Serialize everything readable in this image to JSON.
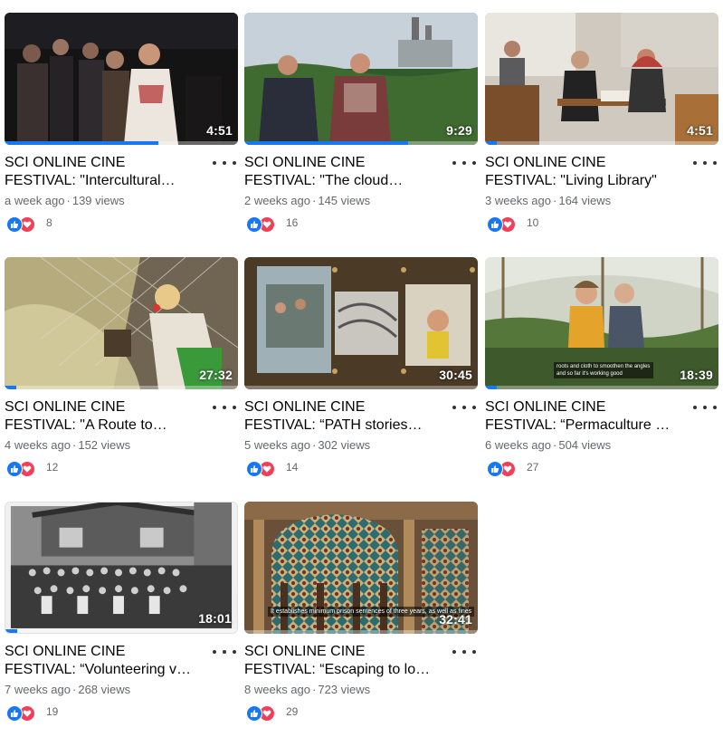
{
  "colors": {
    "accent": "#1877f2",
    "like": "#1877f2",
    "love": "#f33e58",
    "meta_text": "#65676b"
  },
  "icons": {
    "menu": "three-dots-icon",
    "like": "thumbs-up-icon",
    "love": "heart-icon"
  },
  "videos": [
    {
      "title_line1": "SCI ONLINE CINE",
      "title_line2": "FESTIVAL: \"Intercultural…",
      "duration": "4:51",
      "age": "a week ago",
      "views": "139 views",
      "reactions": "8",
      "progress": 0.66
    },
    {
      "title_line1": "SCI ONLINE CINE",
      "title_line2": "FESTIVAL: \"The cloud…",
      "duration": "9:29",
      "age": "2 weeks ago",
      "views": "145 views",
      "reactions": "16",
      "progress": 0.7
    },
    {
      "title_line1": "SCI ONLINE CINE",
      "title_line2": "FESTIVAL: \"Living Library\"",
      "duration": "4:51",
      "age": "3 weeks ago",
      "views": "164 views",
      "reactions": "10",
      "progress": 0.05
    },
    {
      "title_line1": "SCI ONLINE CINE",
      "title_line2": "FESTIVAL: \"A Route to…",
      "duration": "27:32",
      "age": "4 weeks ago",
      "views": "152 views",
      "reactions": "12",
      "progress": 0.05
    },
    {
      "title_line1": "SCI ONLINE CINE",
      "title_line2": "FESTIVAL: “PATH stories…",
      "duration": "30:45",
      "age": "5 weeks ago",
      "views": "302 views",
      "reactions": "14",
      "progress": 0.0
    },
    {
      "title_line1": "SCI ONLINE CINE",
      "title_line2": "FESTIVAL: “Permaculture …",
      "duration": "18:39",
      "age": "6 weeks ago",
      "views": "504 views",
      "reactions": "27",
      "progress": 0.05,
      "subtitle_text": "roots and cloth to smoothen the angles and so far it's working good"
    },
    {
      "title_line1": "SCI ONLINE CINE",
      "title_line2": "FESTIVAL: “Volunteering v…",
      "duration": "18:01",
      "age": "7 weeks ago",
      "views": "268 views",
      "reactions": "19",
      "progress": 0.05
    },
    {
      "title_line1": "SCI ONLINE CINE",
      "title_line2": "FESTIVAL: “Escaping to lo…",
      "duration": "32:41",
      "age": "8 weeks ago",
      "views": "723 views",
      "reactions": "29",
      "progress": 0.0,
      "subtitle_text": "It establishes minimum prison sentences of three years, as well as fines"
    }
  ]
}
